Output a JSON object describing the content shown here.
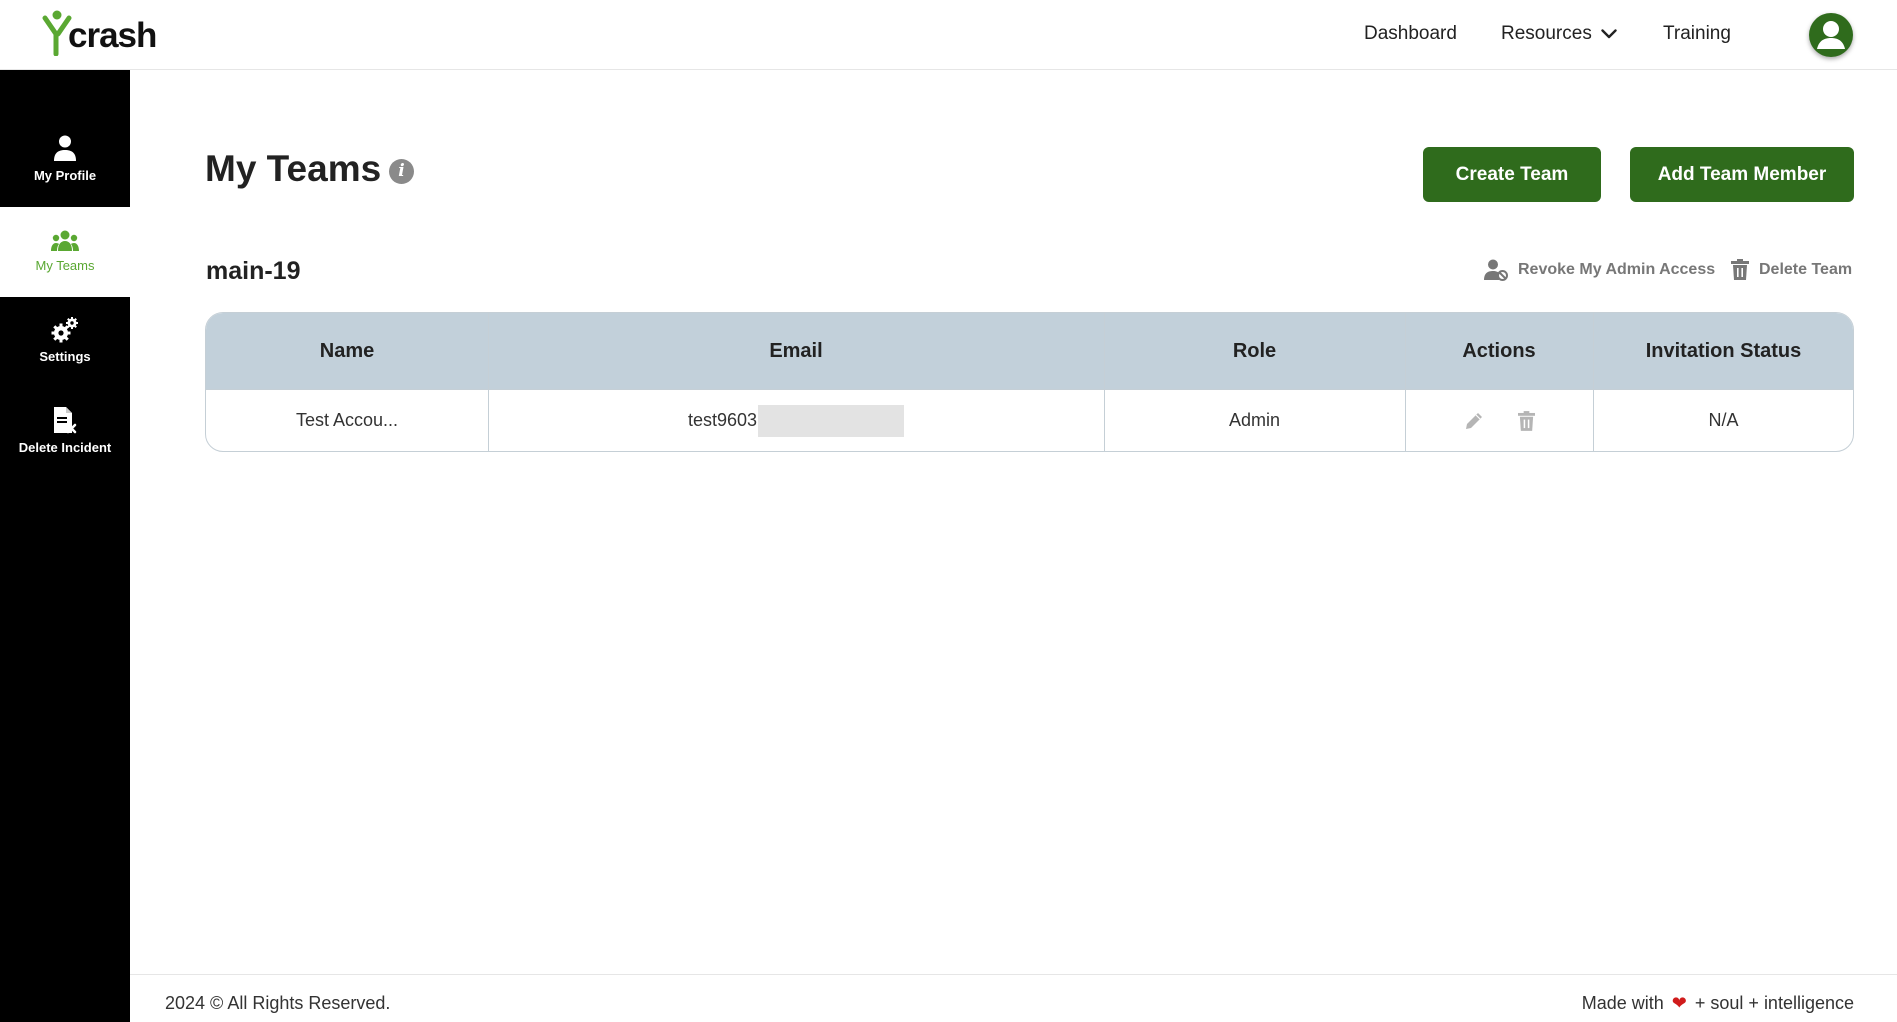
{
  "brand": {
    "logo_text": "crash",
    "accent_color": "#2f6b1c",
    "logo_accent": "#5aa832"
  },
  "nav": {
    "dashboard": "Dashboard",
    "resources": "Resources",
    "training": "Training"
  },
  "sidebar": {
    "items": [
      {
        "label": "My Profile",
        "icon": "user-icon",
        "active": false
      },
      {
        "label": "My Teams",
        "icon": "users-icon",
        "active": true
      },
      {
        "label": "Settings",
        "icon": "gears-icon",
        "active": false
      },
      {
        "label": "Delete Incident",
        "icon": "delete-file-icon",
        "active": false
      }
    ]
  },
  "main": {
    "title": "My Teams",
    "create_team_label": "Create Team",
    "add_member_label": "Add Team Member",
    "team": {
      "name": "main-19",
      "revoke_label": "Revoke My Admin Access",
      "delete_label": "Delete Team"
    },
    "table": {
      "columns": [
        "Name",
        "Email",
        "Role",
        "Actions",
        "Invitation Status"
      ],
      "rows": [
        {
          "name": "Test Accou...",
          "email": "test9603",
          "role": "Admin",
          "status": "N/A"
        }
      ]
    }
  },
  "footer": {
    "copyright": "2024 © All Rights Reserved.",
    "made_with": "Made with",
    "made_rest": "+ soul + intelligence"
  }
}
